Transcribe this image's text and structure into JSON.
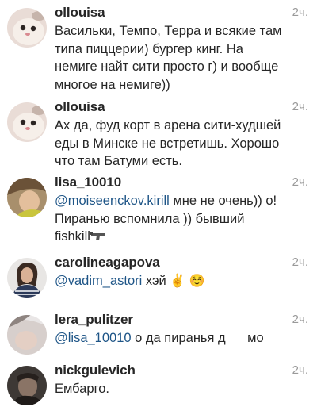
{
  "comments": [
    {
      "username": "ollouisa",
      "time": "2ч.",
      "text": "Васильки, Темпо, Терра и всякие там\nтипа пиццерии) бургер кинг. На\nнемиге найт сити просто г) и вообще\nмногое на немиге))"
    },
    {
      "username": "ollouisa",
      "time": "2ч.",
      "text": "Ах да, фуд корт в арена сити-худшей\nеды в Минске не встретишь. Хорошо\nчто там Батуми есть."
    },
    {
      "username": "lisa_10010",
      "time": "2ч.",
      "mention": "@moiseenckov.kirill",
      "text_after": " мне не очень)) о!\nПиранью вспомнила )) бывший\nfishkill"
    },
    {
      "username": "carolineagapova",
      "time": "2ч.",
      "mention": "@vadim_astori",
      "text_after": " хэй ",
      "emojis": "✌️ ☺️"
    },
    {
      "username": "lera_pulitzer",
      "time": "2ч.",
      "mention": "@lisa_10010",
      "text_after": " о да пиранья д      мо"
    },
    {
      "username": "nickgulevich",
      "time": "2ч.",
      "text": "Ембарго."
    }
  ],
  "icons": {
    "gun": "pistol-emoji",
    "peace": "victory-hand-emoji",
    "smile": "smiling-face-emoji"
  },
  "colors": {
    "username": "#262626",
    "mention": "#1e5587",
    "timestamp": "#9a9a9a"
  }
}
